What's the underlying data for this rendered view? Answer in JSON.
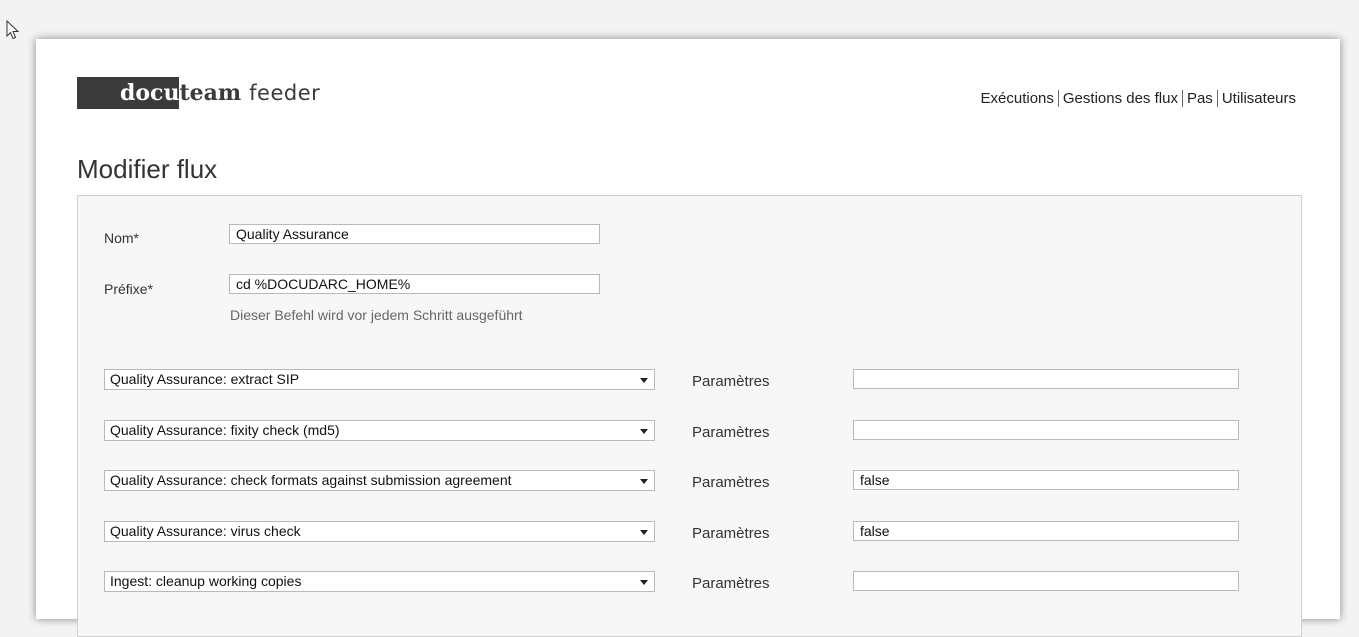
{
  "app": {
    "logo_docu": "docu",
    "logo_team": "team",
    "logo_feeder": "feeder"
  },
  "nav": {
    "items": [
      {
        "label": "Exécutions"
      },
      {
        "label": "Gestions des flux"
      },
      {
        "label": "Pas"
      },
      {
        "label": "Utilisateurs"
      }
    ]
  },
  "page": {
    "title": "Modifier flux"
  },
  "form": {
    "name_label": "Nom*",
    "name_value": "Quality Assurance",
    "prefix_label": "Préfixe*",
    "prefix_value": "cd %DOCUDARC_HOME%",
    "prefix_hint": "Dieser Befehl wird vor jedem Schritt ausgeführt",
    "steps": [
      {
        "step": "Quality Assurance: extract SIP",
        "param_label": "Paramètres",
        "param_value": ""
      },
      {
        "step": "Quality Assurance: fixity check (md5)",
        "param_label": "Paramètres",
        "param_value": ""
      },
      {
        "step": "Quality Assurance: check formats against submission agreement",
        "param_label": "Paramètres",
        "param_value": "false"
      },
      {
        "step": "Quality Assurance: virus check",
        "param_label": "Paramètres",
        "param_value": "false"
      },
      {
        "step": "Ingest: cleanup working copies",
        "param_label": "Paramètres",
        "param_value": ""
      }
    ]
  }
}
